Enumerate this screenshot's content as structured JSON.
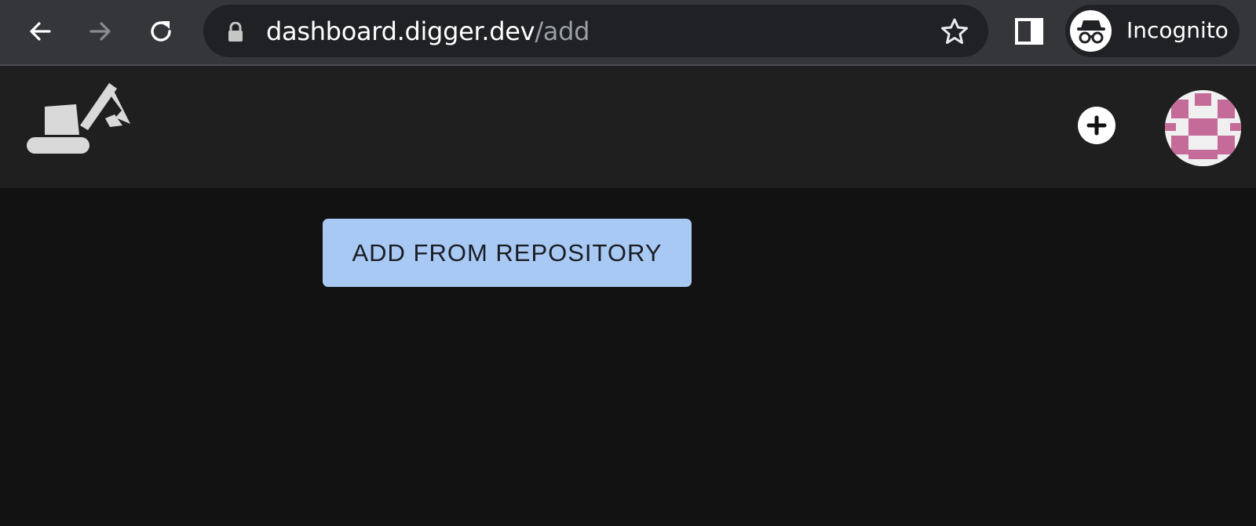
{
  "browser": {
    "url_host": "dashboard.digger.dev",
    "url_path": "/add",
    "profile_label": "Incognito",
    "icons": {
      "back": "back-arrow-icon",
      "forward": "forward-arrow-icon",
      "reload": "reload-icon",
      "lock": "lock-icon",
      "bookmark": "star-icon",
      "side_panel": "side-panel-icon",
      "incognito": "incognito-icon"
    }
  },
  "header": {
    "logo": "digger-excavator-logo",
    "add_icon": "plus-circle-icon",
    "avatar": "user-avatar"
  },
  "main": {
    "add_from_repository_label": "ADD FROM REPOSITORY"
  },
  "colors": {
    "button_bg": "#a8c9f4",
    "avatar_pattern": "#c56b99",
    "page_bg": "#121212",
    "header_bg": "#1f1f1f"
  }
}
